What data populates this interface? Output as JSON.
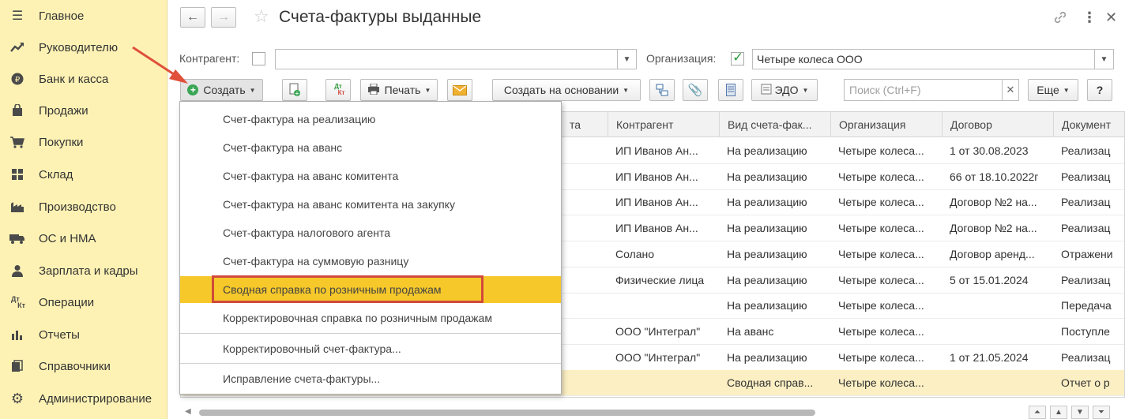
{
  "sidebar": {
    "items": [
      {
        "label": "Главное",
        "icon": "menu-icon"
      },
      {
        "label": "Руководителю",
        "icon": "trend-icon"
      },
      {
        "label": "Банк и касса",
        "icon": "coin-icon"
      },
      {
        "label": "Продажи",
        "icon": "bag-icon"
      },
      {
        "label": "Покупки",
        "icon": "cart-icon"
      },
      {
        "label": "Склад",
        "icon": "grid-icon"
      },
      {
        "label": "Производство",
        "icon": "factory-icon"
      },
      {
        "label": "ОС и НМА",
        "icon": "truck-icon"
      },
      {
        "label": "Зарплата и кадры",
        "icon": "person-icon"
      },
      {
        "label": "Операции",
        "icon": "dt-kt-icon"
      },
      {
        "label": "Отчеты",
        "icon": "bar-chart-icon"
      },
      {
        "label": "Справочники",
        "icon": "books-icon"
      },
      {
        "label": "Администрирование",
        "icon": "gear-icon"
      }
    ]
  },
  "header": {
    "title": "Счета-фактуры выданные",
    "back": "←",
    "forward": "→"
  },
  "filters": {
    "counterparty_label": "Контрагент:",
    "counterparty_value": "",
    "organization_label": "Организация:",
    "organization_value": "Четыре колеса ООО"
  },
  "toolbar": {
    "create_label": "Создать",
    "print_label": "Печать",
    "create_based_label": "Создать на основании",
    "edo_label": "ЭДО",
    "search_placeholder": "Поиск (Ctrl+F)",
    "more_label": "Еще",
    "help_label": "?",
    "dtkt_label": "Дт Кт"
  },
  "table": {
    "columns": [
      "та",
      "Контрагент",
      "Вид счета-фак...",
      "Организация",
      "Договор",
      "Документ"
    ],
    "rows": [
      [
        "",
        "ИП Иванов Ан...",
        "На реализацию",
        "Четыре колеса...",
        "1 от 30.08.2023",
        "Реализац"
      ],
      [
        "",
        "ИП Иванов Ан...",
        "На реализацию",
        "Четыре колеса...",
        "66 от 18.10.2022г",
        "Реализац"
      ],
      [
        "",
        "ИП Иванов Ан...",
        "На реализацию",
        "Четыре колеса...",
        "Договор №2 на...",
        "Реализац"
      ],
      [
        "",
        "ИП Иванов Ан...",
        "На реализацию",
        "Четыре колеса...",
        "Договор №2 на...",
        "Реализац"
      ],
      [
        "",
        "Солано",
        "На реализацию",
        "Четыре колеса...",
        "Договор аренд...",
        "Отражени"
      ],
      [
        "",
        "Физические лица",
        "На реализацию",
        "Четыре колеса...",
        "5 от 15.01.2024",
        "Реализац"
      ],
      [
        "",
        "",
        "На реализацию",
        "Четыре колеса...",
        "",
        "Передача"
      ],
      [
        "",
        "ООО \"Интеграл\"",
        "На аванс",
        "Четыре колеса...",
        "",
        "Поступле"
      ],
      [
        "",
        "ООО \"Интеграл\"",
        "На реализацию",
        "Четыре колеса...",
        "1 от 21.05.2024",
        "Реализац"
      ],
      [
        "",
        "",
        "Сводная справ...",
        "Четыре колеса...",
        "",
        "Отчет о р"
      ]
    ]
  },
  "menu": {
    "items": [
      "Счет-фактура на реализацию",
      "Счет-фактура на аванс",
      "Счет-фактура на аванс комитента",
      "Счет-фактура на аванс комитента на закупку",
      "Счет-фактура налогового агента",
      "Счет-фактура на суммовую разницу",
      "Сводная справка по розничным продажам",
      "Корректировочная справка по розничным продажам",
      "Корректировочный счет-фактура...",
      "Исправление счета-фактуры..."
    ]
  },
  "colors": {
    "sidebar_bg": "#fdf2b4",
    "highlight": "#f6c829",
    "annotation_red": "#d04a3c",
    "selected_row": "#fbefc3"
  }
}
